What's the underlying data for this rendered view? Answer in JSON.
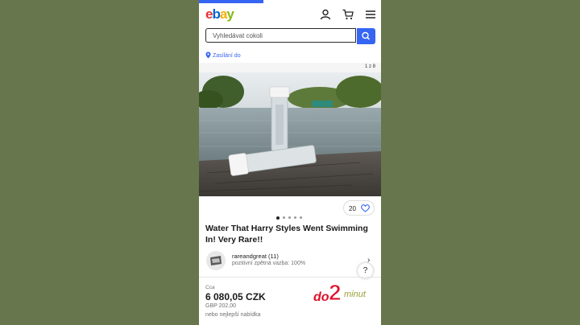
{
  "header": {
    "logo_letters": [
      "e",
      "b",
      "a",
      "y"
    ],
    "icons": [
      "user-icon",
      "cart-icon",
      "menu-icon"
    ]
  },
  "search": {
    "placeholder": "Vyhledávat cokoli",
    "button_icon": "search-icon"
  },
  "shipping": {
    "label": "Zasílání do",
    "icon": "location-pin-icon"
  },
  "gallery": {
    "counter": "1 z 8",
    "dots_total": 5,
    "active_dot": 1
  },
  "watchers": {
    "count": "20",
    "icon": "heart-icon"
  },
  "listing": {
    "title": "Water That Harry Styles Went Swimming In! Very Rare!!"
  },
  "seller": {
    "name": "rareandgreat (11)",
    "feedback": "pozitivní zpětná vazba: 100%"
  },
  "help": {
    "label": "?"
  },
  "pricing": {
    "approx_label": "Cca",
    "price": "6 080,05 CZK",
    "original_price": "GBP 202,00",
    "best_offer": "nebo nejlepší nabídka"
  },
  "watermark": {
    "text": "do2minut"
  },
  "colors": {
    "accent": "#3665f3",
    "background": "#67764c"
  }
}
